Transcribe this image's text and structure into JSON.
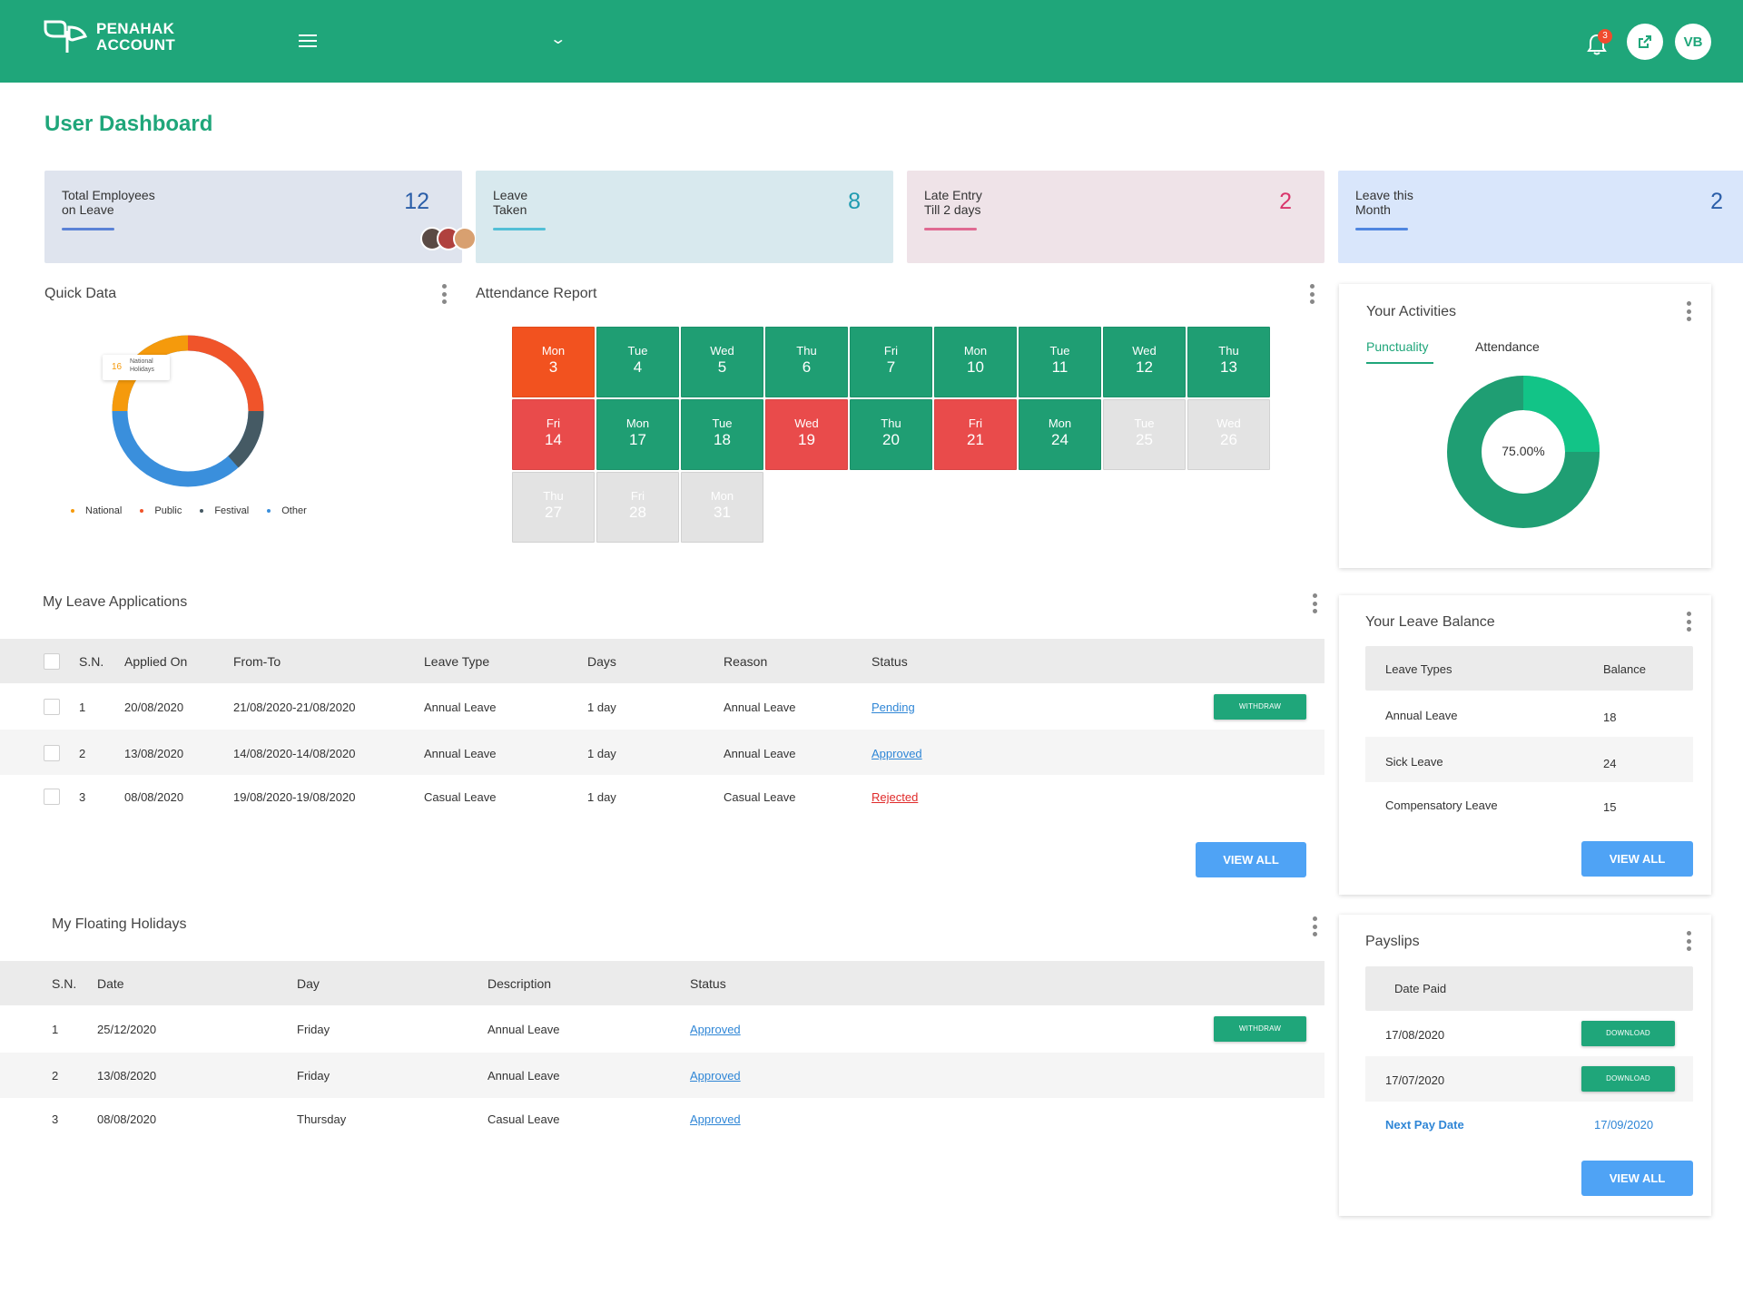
{
  "header": {
    "brand_line1": "PENAHAK",
    "brand_line2": "ACCOUNT",
    "notification_count": "3",
    "user_initials": "VB"
  },
  "page_title": "User Dashboard",
  "stats": [
    {
      "label": "Total Employees\non Leave",
      "value": "12",
      "color": "#2b5ea8"
    },
    {
      "label": "Leave\nTaken",
      "value": "8",
      "color": "#1f9bb0"
    },
    {
      "label": "Late Entry\nTill 2 days",
      "value": "2",
      "color": "#d9356b"
    },
    {
      "label": "Leave this\nMonth",
      "value": "2",
      "color": "#2b5ea8"
    }
  ],
  "quick_data": {
    "title": "Quick Data",
    "tooltip_value": "16",
    "tooltip_label1": "National",
    "tooltip_label2": "Holidays",
    "legend": [
      {
        "label": "National",
        "color": "#f59a0c"
      },
      {
        "label": "Public",
        "color": "#f0542a"
      },
      {
        "label": "Festival",
        "color": "#455a64"
      },
      {
        "label": "Other",
        "color": "#3a8fdc"
      }
    ]
  },
  "attendance": {
    "title": "Attendance Report",
    "days": [
      {
        "day": "Mon",
        "date": "3",
        "status": "late"
      },
      {
        "day": "Tue",
        "date": "4",
        "status": "present"
      },
      {
        "day": "Wed",
        "date": "5",
        "status": "present"
      },
      {
        "day": "Thu",
        "date": "6",
        "status": "present"
      },
      {
        "day": "Fri",
        "date": "7",
        "status": "present"
      },
      {
        "day": "Mon",
        "date": "10",
        "status": "present"
      },
      {
        "day": "Tue",
        "date": "11",
        "status": "present"
      },
      {
        "day": "Wed",
        "date": "12",
        "status": "present"
      },
      {
        "day": "Thu",
        "date": "13",
        "status": "present"
      },
      {
        "day": "Fri",
        "date": "14",
        "status": "absent"
      },
      {
        "day": "Mon",
        "date": "17",
        "status": "present"
      },
      {
        "day": "Tue",
        "date": "18",
        "status": "present"
      },
      {
        "day": "Wed",
        "date": "19",
        "status": "absent"
      },
      {
        "day": "Thu",
        "date": "20",
        "status": "present"
      },
      {
        "day": "Fri",
        "date": "21",
        "status": "absent"
      },
      {
        "day": "Mon",
        "date": "24",
        "status": "present"
      },
      {
        "day": "Tue",
        "date": "25",
        "status": "future"
      },
      {
        "day": "Wed",
        "date": "26",
        "status": "future"
      },
      {
        "day": "Thu",
        "date": "27",
        "status": "future"
      },
      {
        "day": "Fri",
        "date": "28",
        "status": "future"
      },
      {
        "day": "Mon",
        "date": "31",
        "status": "future"
      }
    ],
    "colors": {
      "present": "#1f9e73",
      "absent": "#e94b4b",
      "late": "#f2521f",
      "future": "#e3e3e3"
    }
  },
  "activities": {
    "title": "Your Activities",
    "tab_punctuality": "Punctuality",
    "tab_attendance": "Attendance",
    "percent_label": "75.00%",
    "percent": 75
  },
  "leave_applications": {
    "title": "My Leave Applications",
    "headers": [
      "S.N.",
      "Applied On",
      "From-To",
      "Leave Type",
      "Days",
      "Reason",
      "Status"
    ],
    "rows": [
      {
        "sn": "1",
        "applied": "20/08/2020",
        "fromto": "21/08/2020-21/08/2020",
        "type": "Annual Leave",
        "days": "1 day",
        "reason": "Annual Leave",
        "status": "Pending",
        "status_color": "#2f86d6"
      },
      {
        "sn": "2",
        "applied": "13/08/2020",
        "fromto": "14/08/2020-14/08/2020",
        "type": "Annual Leave",
        "days": "1 day",
        "reason": "Annual Leave",
        "status": "Approved",
        "status_color": "#2f86d6"
      },
      {
        "sn": "3",
        "applied": "08/08/2020",
        "fromto": "19/08/2020-19/08/2020",
        "type": "Casual Leave",
        "days": "1 day",
        "reason": "Casual Leave",
        "status": "Rejected",
        "status_color": "#e02b2b"
      }
    ],
    "withdraw_label": "WITHDRAW",
    "view_all": "VIEW ALL"
  },
  "floating_holidays": {
    "title": "My Floating Holidays",
    "headers": [
      "S.N.",
      "Date",
      "Day",
      "Description",
      "Status"
    ],
    "rows": [
      {
        "sn": "1",
        "date": "25/12/2020",
        "day": "Friday",
        "desc": "Annual Leave",
        "status": "Approved"
      },
      {
        "sn": "2",
        "date": "13/08/2020",
        "day": "Friday",
        "desc": "Annual Leave",
        "status": "Approved"
      },
      {
        "sn": "3",
        "date": "08/08/2020",
        "day": "Thursday",
        "desc": "Casual Leave",
        "status": "Approved"
      }
    ],
    "withdraw_label": "WITHDRAW"
  },
  "leave_balance": {
    "title": "Your Leave Balance",
    "col_type": "Leave Types",
    "col_balance": "Balance",
    "rows": [
      {
        "type": "Annual Leave",
        "balance": "18"
      },
      {
        "type": "Sick Leave",
        "balance": "24"
      },
      {
        "type": "Compensatory Leave",
        "balance": "15"
      }
    ],
    "view_all": "VIEW ALL"
  },
  "payslips": {
    "title": "Payslips",
    "col_date": "Date Paid",
    "rows": [
      {
        "date": "17/08/2020"
      },
      {
        "date": "17/07/2020"
      }
    ],
    "download_label": "DOWNLOAD",
    "next_pay_label": "Next Pay Date",
    "next_pay_date": "17/09/2020",
    "view_all": "VIEW ALL"
  }
}
